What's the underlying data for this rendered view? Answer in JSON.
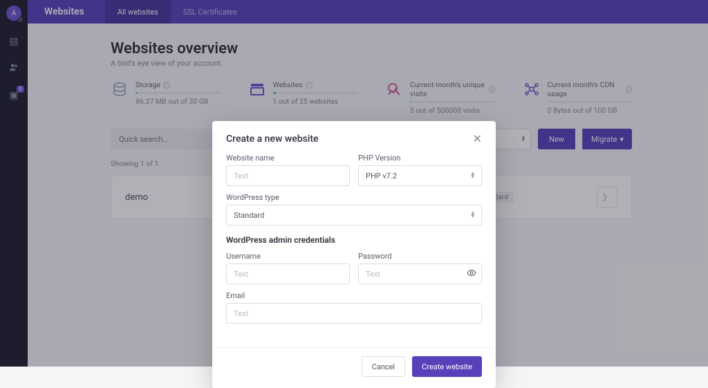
{
  "sidebar": {
    "avatar_initial": "A",
    "badge": "0"
  },
  "topbar": {
    "brand": "Websites",
    "tabs": [
      "All websites",
      "SSL Certificates"
    ],
    "active_tab": 0
  },
  "page": {
    "title": "Websites overview",
    "subtitle": "A bird's eye view of your account."
  },
  "stats": [
    {
      "label": "Storage",
      "value": "86.27 MB out of 30 GB",
      "fill": 2,
      "icon": "storage-icon",
      "color": "#a9b4c4"
    },
    {
      "label": "Websites",
      "value": "1 out of 25 websites",
      "fill": 4,
      "icon": "websites-icon",
      "color": "#6e52d2"
    },
    {
      "label": "Current month's unique visits",
      "value": "5 out of 500000 visits",
      "fill": 1,
      "icon": "visits-icon",
      "color": "#d85fa4"
    },
    {
      "label": "Current month's CDN usage",
      "value": "0 Bytes out of 100 GB",
      "fill": 0,
      "icon": "cdn-icon",
      "color": "#6e52d2"
    }
  ],
  "toolbar": {
    "search_placeholder": "Quick search...",
    "new": "New",
    "migrate": "Migrate"
  },
  "listing": {
    "showing": "Showing 1 of 1",
    "rows": [
      {
        "name": "demo",
        "tag": "andard"
      }
    ]
  },
  "modal": {
    "title": "Create a new website",
    "labels": {
      "website_name": "Website name",
      "php_version": "PHP Version",
      "wordpress_type": "WordPress type",
      "section": "WordPress admin credentials",
      "username": "Username",
      "password": "Password",
      "email": "Email"
    },
    "values": {
      "php_version": "PHP v7.2",
      "wordpress_type": "Standard"
    },
    "placeholder": "Text",
    "buttons": {
      "cancel": "Cancel",
      "create": "Create website"
    }
  }
}
